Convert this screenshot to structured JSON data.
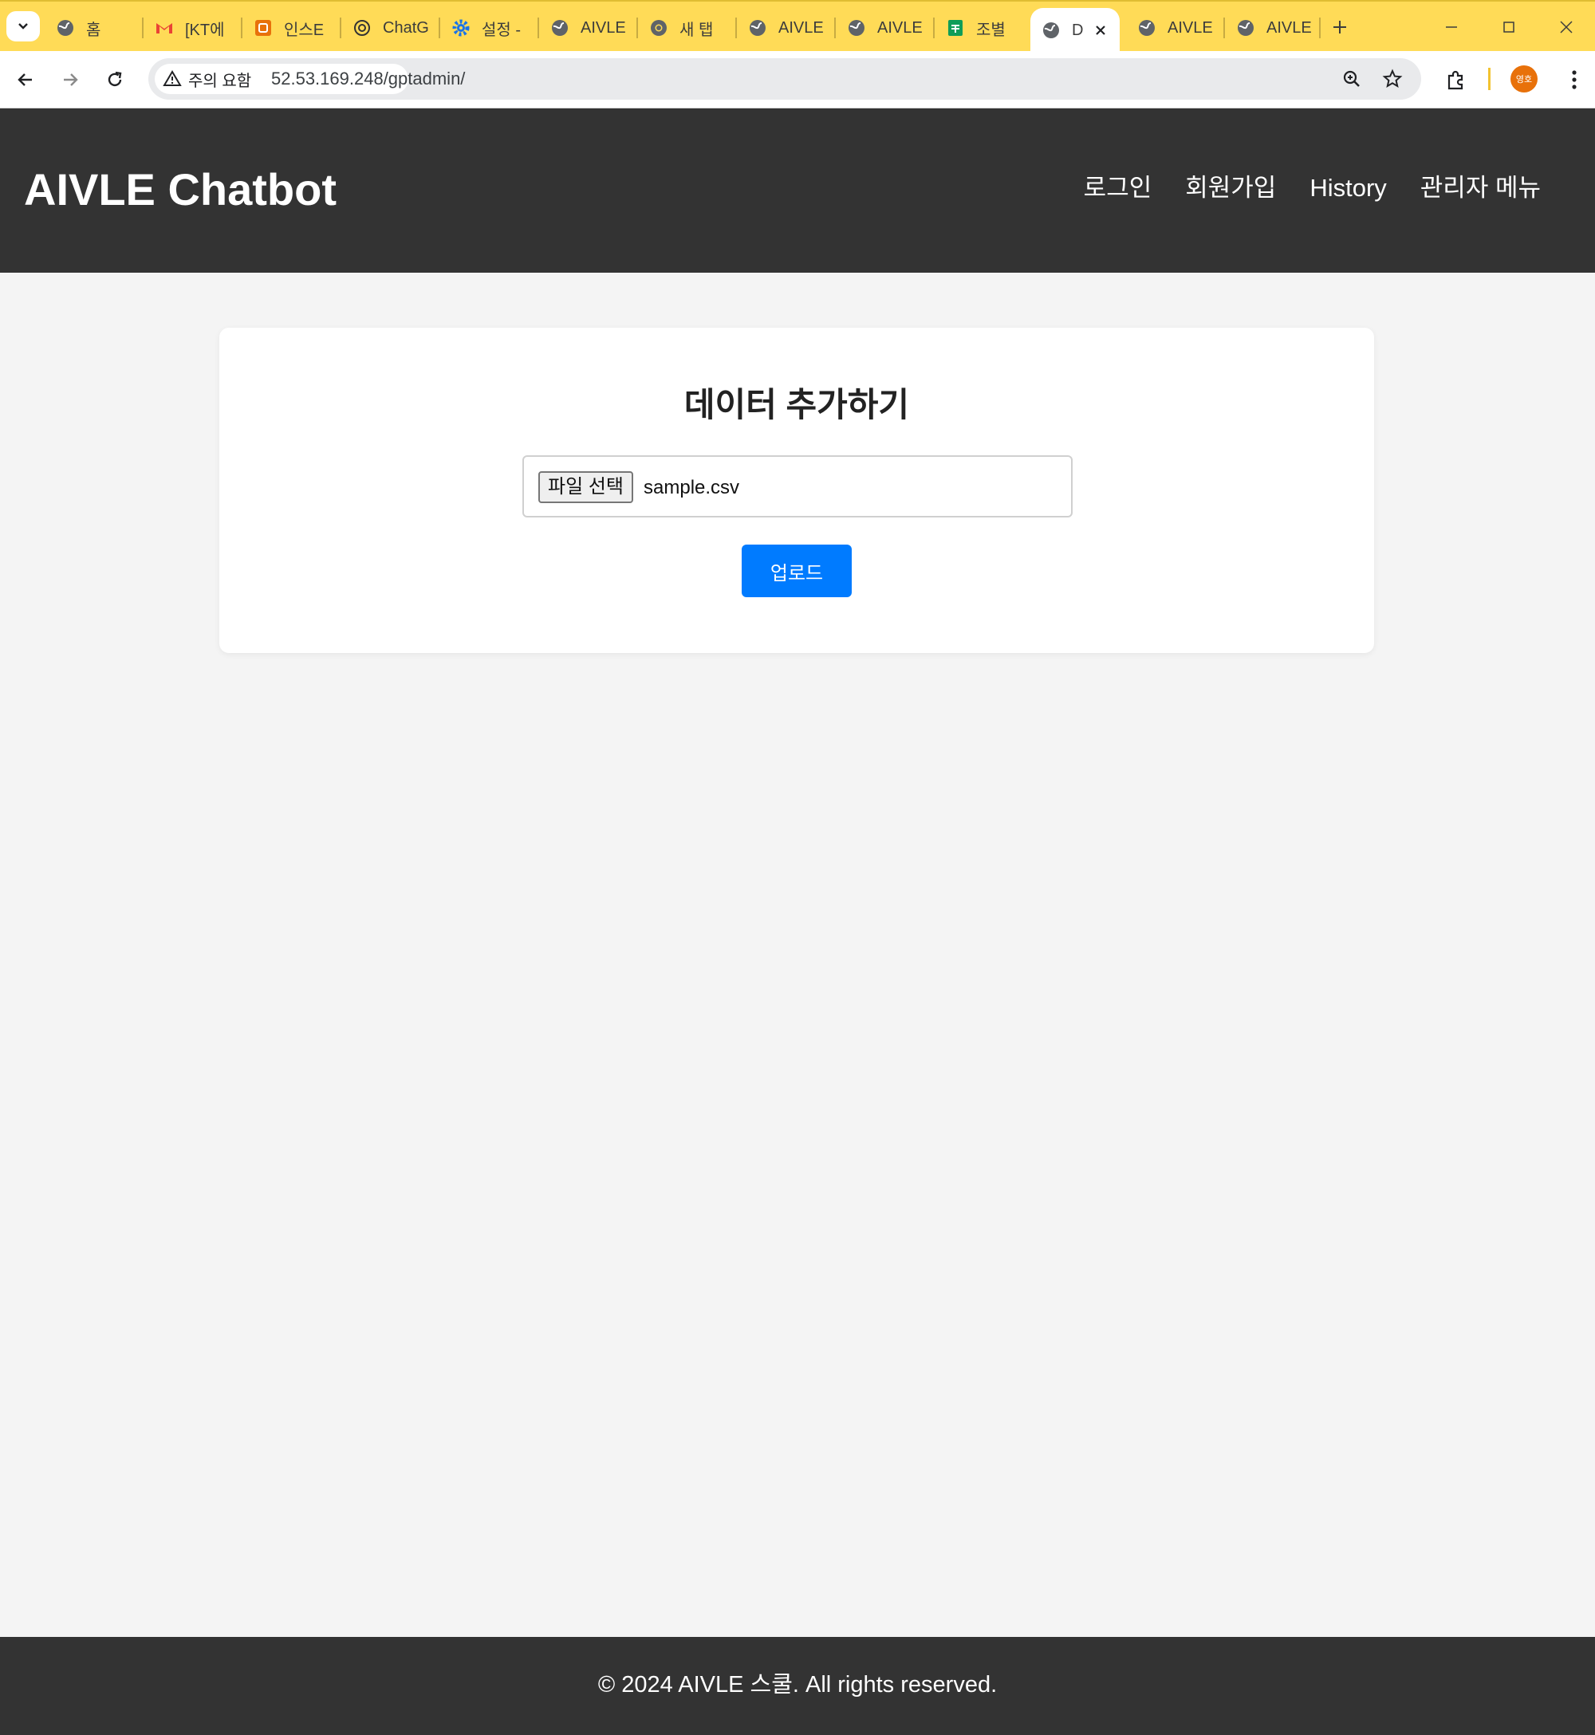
{
  "browser": {
    "tabs": [
      {
        "title": "홈",
        "icon": "globe-icon"
      },
      {
        "title": "[KT에",
        "icon": "gmail-icon"
      },
      {
        "title": "인스E",
        "icon": "app-icon"
      },
      {
        "title": "ChatG",
        "icon": "openai-icon"
      },
      {
        "title": "설정 -",
        "icon": "settings-gear-icon"
      },
      {
        "title": "AIVLE",
        "icon": "globe-icon"
      },
      {
        "title": "새 탭",
        "icon": "chrome-icon"
      },
      {
        "title": "AIVLE",
        "icon": "globe-icon"
      },
      {
        "title": "AIVLE",
        "icon": "globe-icon"
      },
      {
        "title": "조별",
        "icon": "sheets-icon"
      },
      {
        "title": "D",
        "icon": "globe-icon",
        "active": true
      },
      {
        "title": "AIVLE",
        "icon": "globe-icon"
      },
      {
        "title": "AIVLE",
        "icon": "globe-icon"
      }
    ],
    "security_label": "주의 요함",
    "url": "52.53.169.248/gptadmin/",
    "profile_initials": "영호",
    "colors": {
      "tab_strip": "#ffdb57",
      "avatar": "#e8710a"
    }
  },
  "site": {
    "brand": "AIVLE Chatbot",
    "nav": [
      "로그인",
      "회원가입",
      "History",
      "관리자 메뉴"
    ]
  },
  "upload_card": {
    "title": "데이터 추가하기",
    "file_button_label": "파일 선택",
    "file_name": "sample.csv",
    "upload_label": "업로드",
    "accent_color": "#007bff"
  },
  "footer": {
    "text": "© 2024 AIVLE 스쿨. All rights reserved."
  }
}
